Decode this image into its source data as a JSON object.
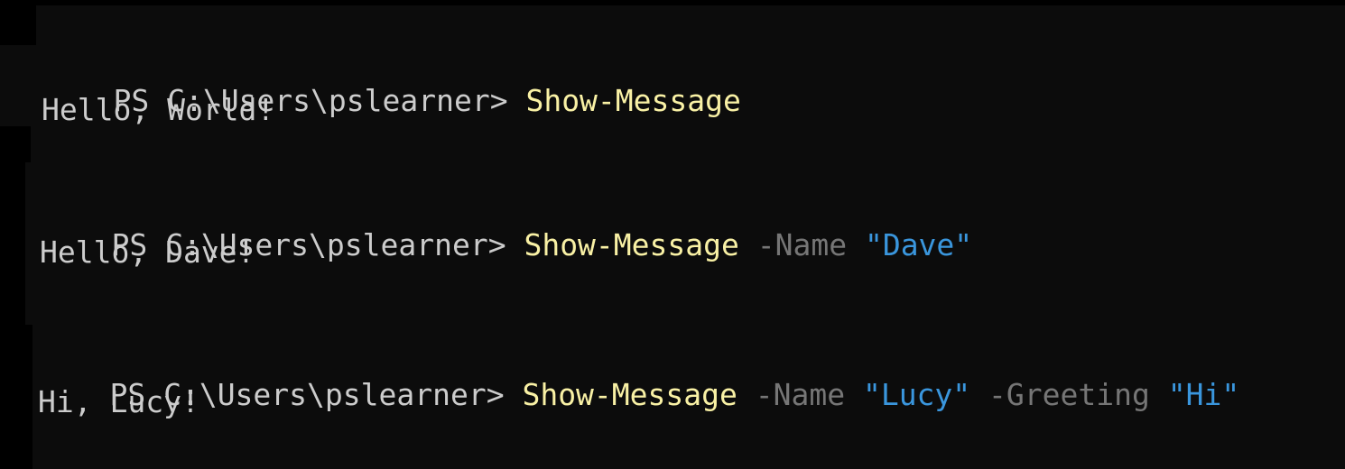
{
  "terminal": {
    "sessions": [
      {
        "prompt": "PS C:\\Users\\pslearner> ",
        "command": "Show-Message",
        "args": [],
        "output": "Hello, World!"
      },
      {
        "prompt": "PS C:\\Users\\pslearner> ",
        "command": "Show-Message",
        "args": [
          {
            "param": " -Name ",
            "value": "\"Dave\""
          }
        ],
        "output": "Hello, Dave!"
      },
      {
        "prompt": "PS C:\\Users\\pslearner> ",
        "command": "Show-Message",
        "args": [
          {
            "param": " -Name ",
            "value": "\"Lucy\""
          },
          {
            "param": " -Greeting ",
            "value": "\"Hi\""
          }
        ],
        "output": "Hi, Lucy!"
      }
    ],
    "colors": {
      "background": "#0c0c0c",
      "prompt": "#cccccc",
      "command": "#f9f1a5",
      "parameter": "#767676",
      "string": "#3a96dd",
      "output": "#cccccc"
    }
  }
}
